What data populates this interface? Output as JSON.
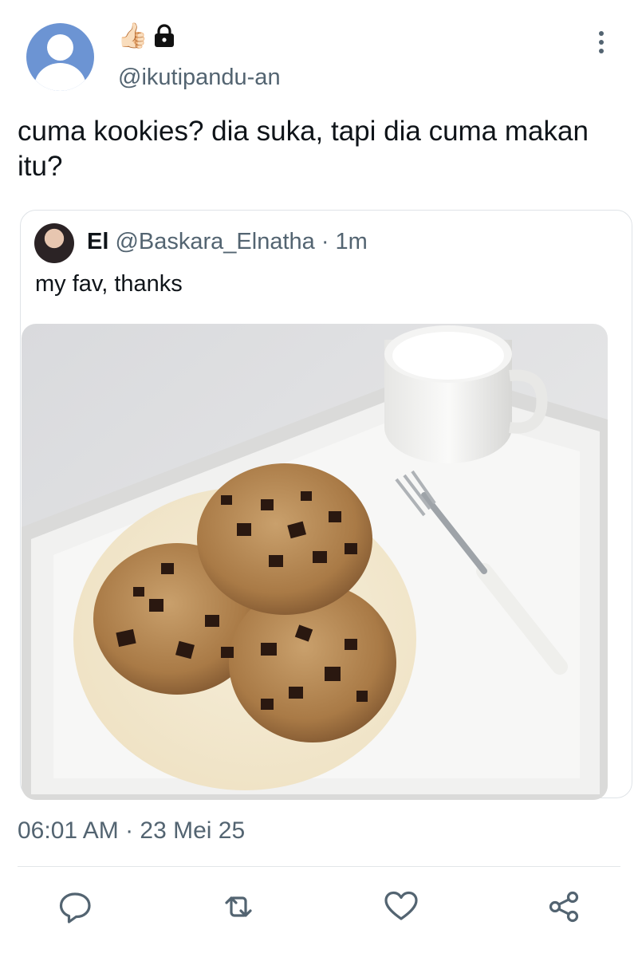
{
  "post": {
    "badge_emoji": "👍🏻",
    "handle": "@ikutipandu-an",
    "text": "cuma kookies? dia suka, tapi dia cuma makan itu?",
    "timestamp": "06:01 AM · 23 Mei 25"
  },
  "quote": {
    "name": "El",
    "handle": "@Baskara_Elnatha",
    "time": "· 1m",
    "text": "my fav, thanks"
  },
  "icons": {
    "lock": "lock-icon",
    "more": "more-vertical-icon",
    "reply": "reply-icon",
    "retweet": "retweet-icon",
    "like": "heart-icon",
    "share": "share-icon"
  },
  "colors": {
    "avatar_bg": "#6c94d3",
    "secondary_text": "#536471",
    "primary_text": "#0f1419"
  }
}
